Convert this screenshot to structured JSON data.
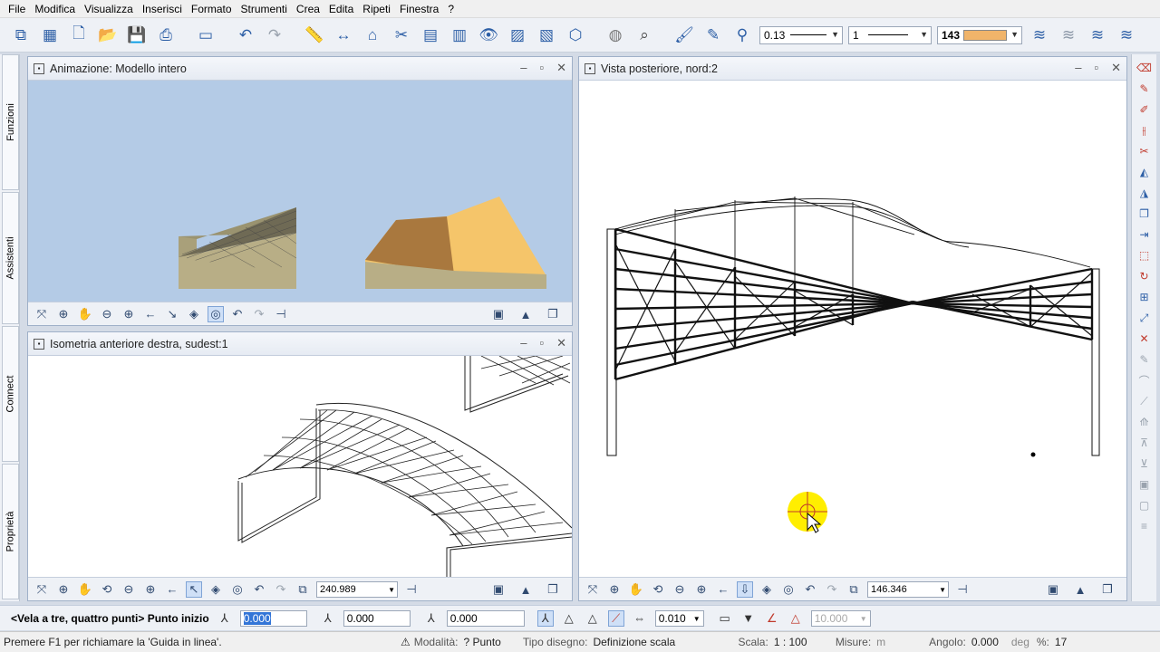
{
  "menu": [
    "File",
    "Modifica",
    "Visualizza",
    "Inserisci",
    "Formato",
    "Strumenti",
    "Crea",
    "Edita",
    "Ripeti",
    "Finestra",
    "?"
  ],
  "toolbar": {
    "pen_thickness": "0.13",
    "line_type": "1",
    "color_number": "143",
    "color_hex": "#f0b46a"
  },
  "sidetabs": [
    "Funzioni",
    "Assistenti",
    "Connect",
    "Proprietà"
  ],
  "windows": {
    "anim": {
      "title": "Animazione: Modello intero"
    },
    "iso": {
      "title": "Isometria anteriore destra, sudest:1",
      "zoom_value": "240.989"
    },
    "rear": {
      "title": "Vista posteriore, nord:2",
      "zoom_value": "146.346"
    }
  },
  "cmdline": {
    "prompt": "<Vela a tre, quattro punti> Punto inizio",
    "x_value": "0.000",
    "y_value": "0.000",
    "z_value": "0.000",
    "delta_value": "0.010",
    "angle_value": "10.000"
  },
  "status": {
    "help_text": "Premere F1 per richiamare la 'Guida in linea'.",
    "mode_label": "Modalità:",
    "mode_value": "? Punto",
    "drawing_type_label": "Tipo disegno:",
    "drawing_type_value": "Definizione scala",
    "scale_label": "Scala:",
    "scale_value": "1 : 100",
    "measure_label": "Misure:",
    "measure_value": "m",
    "angle_label": "Angolo:",
    "angle_value": "0.000",
    "angle_unit": "deg",
    "percent_label": "%:",
    "percent_value": "17"
  },
  "colors": {
    "roof_orange": "#f5c56a",
    "wall_khaki": "#b8ae86",
    "sky_blue": "#b4cbe6",
    "cursor_yellow": "#ffee00"
  }
}
